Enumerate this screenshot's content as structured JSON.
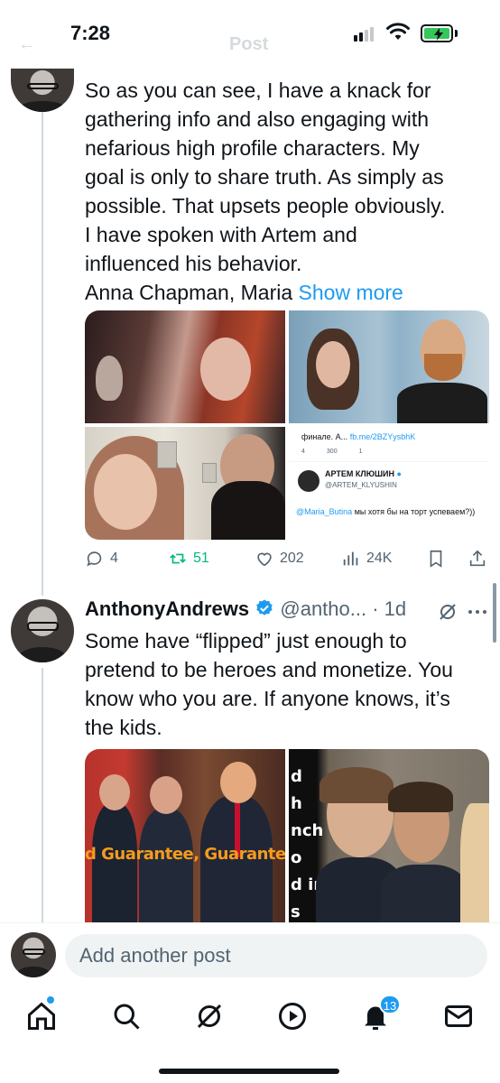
{
  "status_bar": {
    "time": "7:28"
  },
  "header": {
    "back_label": "←",
    "title": "Post"
  },
  "post1": {
    "lines": [
      "So as you can see, I have a knack for",
      "gathering info and also engaging with",
      "nefarious high profile characters. My",
      "goal is only to share truth. As simply as",
      "possible. That upsets people obviously.",
      "I have spoken with Artem and",
      "influenced his behavior."
    ],
    "last_line": "Anna Chapman, Maria",
    "show_more": "Show more",
    "embedded_tweet": {
      "top_text": "финале. А...",
      "top_link": "fb.me/2BZYysbhK",
      "mini_counts": [
        "4",
        "300",
        "1"
      ],
      "author_name": "АРТЕМ КЛЮШИН",
      "author_handle": "@ARTEM_KLYUSHIN",
      "mention": "@Maria_Butina",
      "reply_text": "мы хотя бы на торт успеваем?))"
    },
    "actions": {
      "replies": "4",
      "reposts": "51",
      "likes": "202",
      "views": "24K"
    }
  },
  "post2": {
    "author": "AnthonyAndrews",
    "handle": "@antho...",
    "time": "· 1d",
    "text_lines": [
      "Some have “flipped” just enough to",
      "pretend to be heroes and monetize. You",
      "know who you are. If anyone knows, it’s",
      "the kids."
    ],
    "media_overlay": "d Guarantee, Guaranteed Fr",
    "media_overlay_right": [
      "d",
      "h",
      "nch",
      "o",
      "d in",
      "s"
    ]
  },
  "compose": {
    "placeholder": "Add another post"
  },
  "tabbar": {
    "notifications_badge": "13"
  },
  "colors": {
    "accent": "#1d9bf0",
    "repost_green": "#00ba7c",
    "muted": "#536471"
  }
}
